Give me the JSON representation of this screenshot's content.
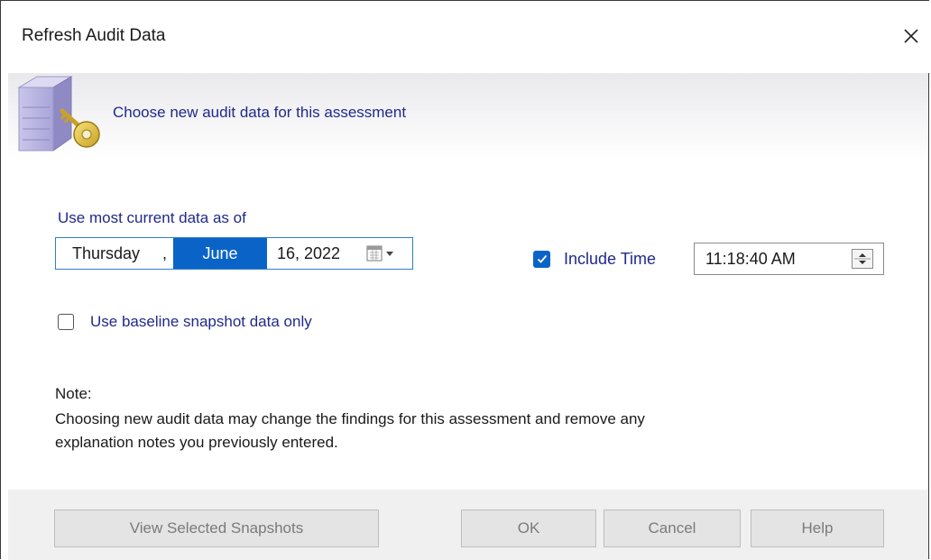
{
  "window": {
    "title": "Refresh Audit Data"
  },
  "header": {
    "subtitle": "Choose new audit data for this assessment"
  },
  "data_as_of": {
    "label": "Use most current data as of",
    "day": "Thursday",
    "separator": ",",
    "month": "June",
    "day_year": "16, 2022"
  },
  "include_time": {
    "label": "Include Time",
    "checked": true,
    "value": "11:18:40 AM"
  },
  "baseline": {
    "label": "Use baseline snapshot data only",
    "checked": false
  },
  "note": {
    "title": "Note:",
    "line1": "Choosing new audit data may change the findings for this assessment and remove any",
    "line2": "explanation notes you previously entered."
  },
  "buttons": {
    "view_snapshots": "View Selected Snapshots",
    "ok": "OK",
    "cancel": "Cancel",
    "help": "Help"
  },
  "colors": {
    "accent": "#0a64c8",
    "label_text": "#1f2a8a",
    "disabled_text": "#7a7a7a"
  }
}
